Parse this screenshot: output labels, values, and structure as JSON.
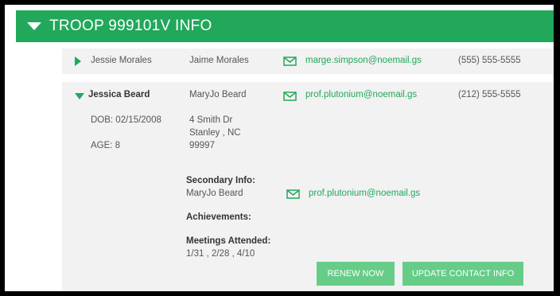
{
  "section": {
    "title": "TROOP 999101V INFO"
  },
  "scouts": [
    {
      "name": "Jessie Morales",
      "guardian": "Jaime Morales",
      "email": "marge.simpson@noemail.gs",
      "phone": "(555) 555-5555",
      "expanded": false
    },
    {
      "name": "Jessica Beard",
      "guardian": "MaryJo Beard",
      "email": "prof.plutonium@noemail.gs",
      "phone": "(212) 555-5555",
      "expanded": true,
      "dob": "DOB: 02/15/2008",
      "age": "AGE: 8",
      "address": {
        "line1": "4 Smith Dr",
        "line2": "Stanley , NC",
        "zip": "99997"
      },
      "secondary": {
        "heading": "Secondary Info:",
        "name": "MaryJo Beard",
        "email": "prof.plutonium@noemail.gs"
      },
      "achievements_heading": "Achievements:",
      "meetings": {
        "heading": "Meetings Attended:",
        "dates": "1/31 , 2/28 , 4/10"
      },
      "buttons": {
        "renew": "RENEW NOW",
        "update": "UPDATE CONTACT INFO"
      }
    }
  ],
  "colors": {
    "accent": "#21a85a",
    "button": "#66cc88",
    "row_bg": "#f2f2f2"
  },
  "icons": {
    "collapse": "triangle-down-icon",
    "expand": "triangle-right-icon",
    "email": "envelope-icon"
  }
}
